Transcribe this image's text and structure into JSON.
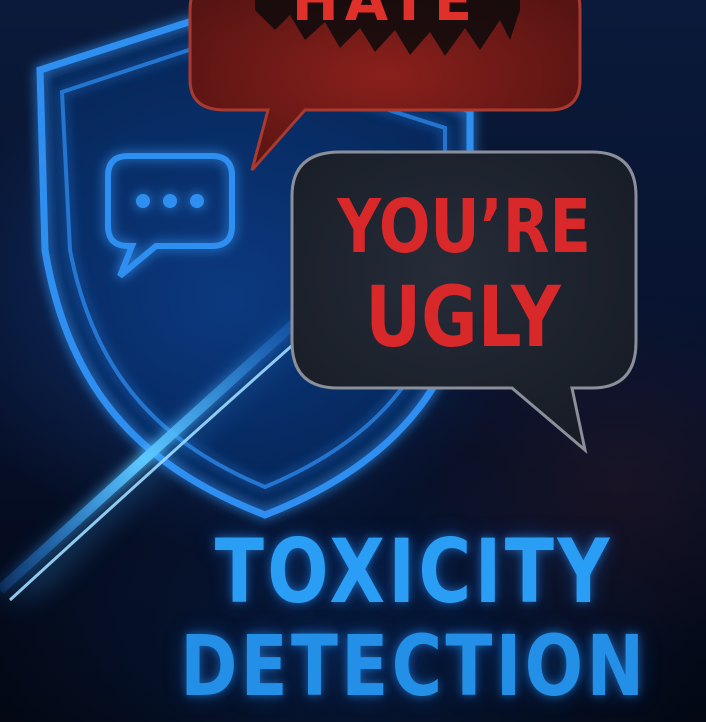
{
  "bubbles": {
    "top_text": "HATE",
    "main_line_1": "YOU’RE",
    "main_line_2": "UGLY"
  },
  "title": {
    "line_1": "TOXICITY",
    "line_2": "DETECTION"
  },
  "colors": {
    "accent_blue": "#2a9df4",
    "toxic_red": "#d8282a",
    "bubble_red": "#7a1c1a",
    "bubble_dark": "#1e2430"
  },
  "icons": [
    "shield-icon",
    "chat-bubble-icon",
    "light-streak"
  ]
}
